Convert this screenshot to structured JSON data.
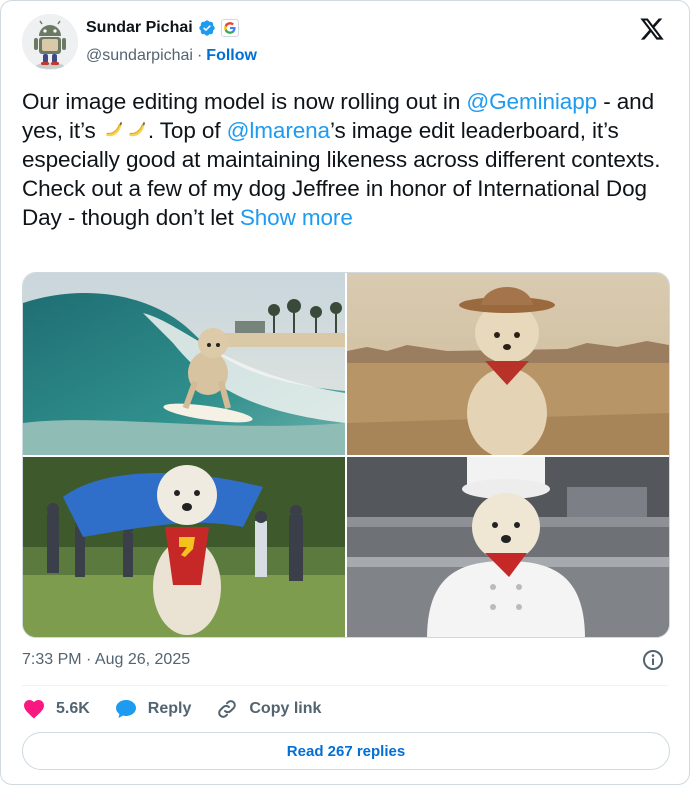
{
  "author": {
    "name": "Sundar Pichai",
    "handle": "@sundarpichai",
    "separator": "·",
    "follow_label": "Follow",
    "avatar_icon": "android-figure-avatar",
    "verified_icon": "verified-badge-icon",
    "affiliation_icon": "google-g-icon"
  },
  "tweet": {
    "t1": "Our image editing model is now rolling out in ",
    "m1": "@Geminiapp",
    "t2": " - and yes, it’s ",
    "t3": ". Top of ",
    "m2": "@lmarena",
    "t4": "’s image edit leaderboard, it’s especially good at maintaining likeness across different contexts. Check out a few of my dog Jeffree in honor of International Dog Day - though don’t let ",
    "show_more": "Show more",
    "emoji": [
      "banana",
      "banana"
    ]
  },
  "media": [
    {
      "subject": "dog surfing a wave"
    },
    {
      "subject": "dog in cowboy hat in desert"
    },
    {
      "subject": "dog in superhero cape"
    },
    {
      "subject": "dog as chef in kitchen"
    }
  ],
  "meta": {
    "timestamp": "7:33 PM · Aug 26, 2025"
  },
  "actions": {
    "likes": "5.6K",
    "reply_label": "Reply",
    "copy_label": "Copy link"
  },
  "replies_button": "Read 267 replies",
  "colors": {
    "accent": "#1d9bf0",
    "link_dark": "#006fd6",
    "like": "#f91880",
    "muted": "#536471"
  }
}
